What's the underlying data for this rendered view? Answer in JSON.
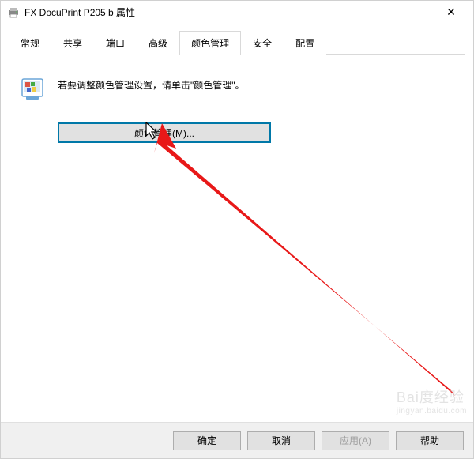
{
  "window": {
    "title": "FX DocuPrint P205 b 属性",
    "close_glyph": "✕"
  },
  "tabs": [
    {
      "label": "常规"
    },
    {
      "label": "共享"
    },
    {
      "label": "端口"
    },
    {
      "label": "高级"
    },
    {
      "label": "颜色管理",
      "active": true
    },
    {
      "label": "安全"
    },
    {
      "label": "配置"
    }
  ],
  "content": {
    "instruction": "若要调整颜色管理设置，请单击\"颜色管理\"。",
    "color_mgmt_button": "颜色管理(M)..."
  },
  "buttons": {
    "ok": "确定",
    "cancel": "取消",
    "apply": "应用(A)",
    "help": "帮助"
  },
  "watermark": {
    "brand": "Bai度经验",
    "sub": "jingyan.baidu.com"
  }
}
